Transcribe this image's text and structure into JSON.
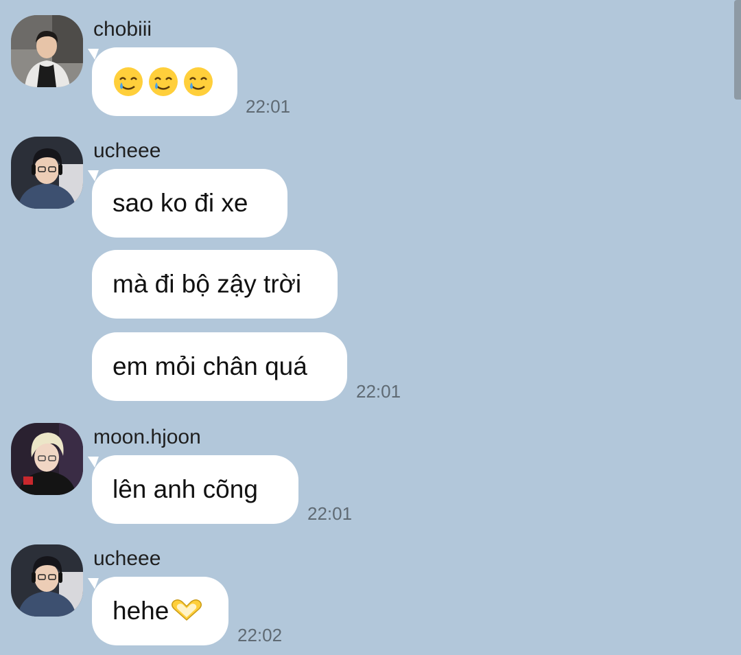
{
  "messages": [
    {
      "sender": "chobiii",
      "avatar_icon": "profile-photo-chobiii",
      "bubbles": [
        {
          "text": "",
          "emoji": [
            "smiling-face-with-tear-icon",
            "smiling-face-with-tear-icon",
            "smiling-face-with-tear-icon"
          ]
        }
      ],
      "time": "22:01"
    },
    {
      "sender": "ucheee",
      "avatar_icon": "profile-photo-ucheee",
      "bubbles": [
        {
          "text": "sao ko đi xe"
        },
        {
          "text": "mà đi bộ zậy trời"
        },
        {
          "text": "em mỏi chân quá"
        }
      ],
      "time": "22:01"
    },
    {
      "sender": "moon.hjoon",
      "avatar_icon": "profile-photo-moon-hjoon",
      "bubbles": [
        {
          "text": "lên anh cõng"
        }
      ],
      "time": "22:01"
    },
    {
      "sender": "ucheee",
      "avatar_icon": "profile-photo-ucheee",
      "bubbles": [
        {
          "text": "hehe",
          "emoji": [
            "heart-hands-icon"
          ]
        }
      ],
      "time": "22:02"
    }
  ],
  "colors": {
    "background": "#b2c7da",
    "bubble": "#ffffff",
    "timestamp": "#5f6a73",
    "emoji_yellow": "#ffcf3b"
  }
}
